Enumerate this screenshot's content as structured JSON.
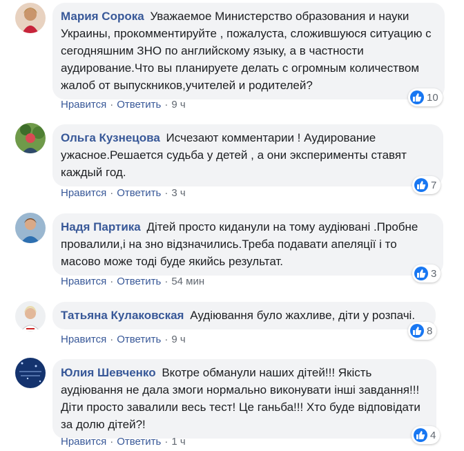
{
  "actions": {
    "like_label": "Нравится",
    "reply_label": "Ответить",
    "separator": "·"
  },
  "comments": [
    {
      "author": "Мария Сорока",
      "text": "Уважаемое Министерство образования и науки Украины, прокомментируйте , пожалуста, сложившуюся ситуацию с сегодняшним ЗНО по английскому языку, а в частности аудирование.Что вы планируете делать с огромным количеством жалоб от выпускников,учителей и родителей?",
      "time": "9 ч",
      "likes": "10"
    },
    {
      "author": "Ольга Кузнецова",
      "text": "Исчезают комментарии ! Аудирование ужасное.Решается судьба у детей , а они эксперименты ставят каждый год.",
      "time": "3 ч",
      "likes": "7"
    },
    {
      "author": "Надя Партика",
      "text": "Дітей просто киданули на тому аудіювані .Пробне провалили,і на зно відзначились.Треба подавати апеляції і то масово може тоді буде якийсь результат.",
      "time": "54 мин",
      "likes": "3"
    },
    {
      "author": "Татьяна Кулаковская",
      "text": "Аудіювання було жахливе, діти у розпачі.",
      "time": "9 ч",
      "likes": "8"
    },
    {
      "author": "Юлия Шевченко",
      "text": "Вкотре обманули наших дітей!!! Якість аудіювання не дала змоги нормально виконувати інші завдання!!! Діти просто завалили весь тест! Це ганьба!!! Хто буде відповідати за долю дітей?!",
      "time": "1 ч",
      "likes": "4"
    }
  ],
  "colors": {
    "author": "#385898",
    "bubble": "#f2f3f5",
    "like_icon": "#1877f2"
  }
}
